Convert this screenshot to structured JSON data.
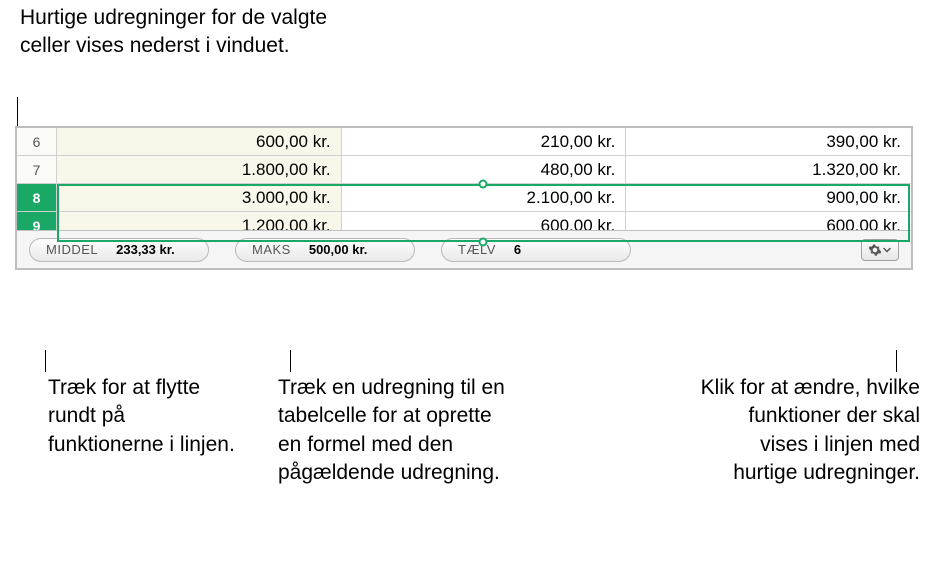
{
  "annotations": {
    "top": "Hurtige udregninger for de valgte celler vises nederst i vinduet.",
    "left": "Træk for at flytte rundt på funktionerne i linjen.",
    "mid": "Træk en udregning til en tabelcelle for at oprette en formel med den pågældende udregning.",
    "right": "Klik for at ændre, hvilke funktioner der skal vises i linjen med hurtige udregninger."
  },
  "rows": [
    {
      "num": "6",
      "selected": false,
      "cells": [
        "600,00 kr.",
        "210,00 kr.",
        "390,00 kr."
      ]
    },
    {
      "num": "7",
      "selected": false,
      "cells": [
        "1.800,00 kr.",
        "480,00 kr.",
        "1.320,00 kr."
      ]
    },
    {
      "num": "8",
      "selected": true,
      "cells": [
        "3.000,00 kr.",
        "2.100,00 kr.",
        "900,00 kr."
      ]
    },
    {
      "num": "9",
      "selected": true,
      "cells": [
        "1.200,00 kr.",
        "600,00 kr.",
        "600,00 kr."
      ]
    }
  ],
  "calcbar": {
    "chips": [
      {
        "label": "MIDDEL",
        "value": "233,33 kr."
      },
      {
        "label": "MAKS",
        "value": "500,00 kr."
      },
      {
        "label": "TÆLV",
        "value": "6"
      }
    ]
  }
}
